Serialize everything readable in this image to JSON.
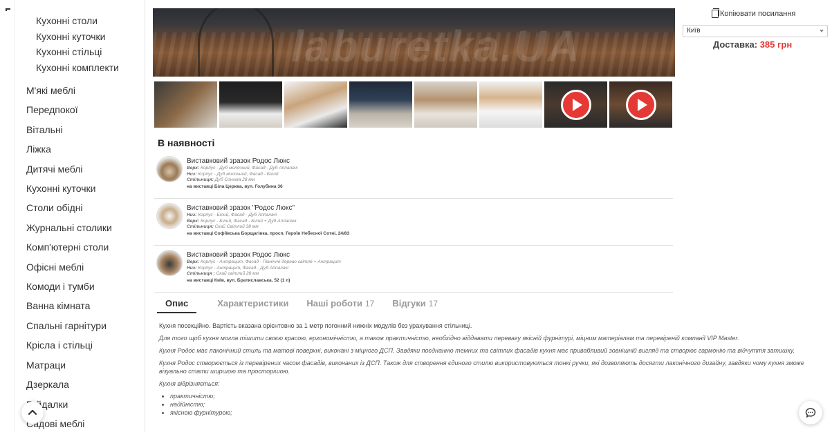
{
  "sidebar": {
    "subcategories": [
      "Кухонні столи",
      "Кухонні куточки",
      "Кухонні стільці",
      "Кухонні комплекти"
    ],
    "categories": [
      "М'які меблі",
      "Передпокої",
      "Вітальні",
      "Ліжка",
      "Дитячі меблі",
      "Кухонні куточки",
      "Столи обідні",
      "Журнальні столики",
      "Комп'ютерні столи",
      "Офісні меблі",
      "Комоди і тумби",
      "Ванна кімната",
      "Спальні гарнітури",
      "Крісла і стільці",
      "Матраци",
      "Дзеркала",
      "Гойдалки",
      "Садові меблі"
    ]
  },
  "gallery": {
    "watermark": "laburetka.UA",
    "thumb_count": 8,
    "video_thumbs": [
      7,
      8
    ]
  },
  "availability": {
    "title": "В наявності",
    "items": [
      {
        "name": "Виставковий зразок Родос Люкс",
        "specs": [
          {
            "label": "Верх:",
            "value": "Корпус - Дуб молочний, Фасад - Дуб Аппалачі"
          },
          {
            "label": "Низ:",
            "value": "Корпус - Дуб молочний, Фасад - Білий"
          },
          {
            "label": "Стільниця:",
            "value": "Дуб Сонома 28 мм"
          }
        ],
        "location": "на виставці Біла Церква, вул. Голубина 36"
      },
      {
        "name": "Виставковий зразок \"Родос Люкс\"",
        "specs": [
          {
            "label": "Низ:",
            "value": "Корпус - Білий, Фасад - Дуб Аппалачі"
          },
          {
            "label": "Верх:",
            "value": "Корпус - Білий, Фасад - Білий + Дуб Аппалачі"
          },
          {
            "label": "Стільниця:",
            "value": "Скай Світлий 38 мм"
          }
        ],
        "location": "на виставці Софіївська Борщагівка, просп. Героїв Небесної Сотні, 24/83"
      },
      {
        "name": "Виставковий зразок Родос Люкс",
        "specs": [
          {
            "label": "Верх:",
            "value": "Корпус - Антрацит, Фасад - Північне дерево світле + Антрацит"
          },
          {
            "label": "Низ:",
            "value": "Корпус - Антрацит, Фасад - Дуб Аппалачі"
          },
          {
            "label": "Стільниця :",
            "value": "Скай світлий 28 мм"
          }
        ],
        "location": "на виставці Київ, вул. Братиславська, 52 (1 п)"
      }
    ]
  },
  "tabs": [
    {
      "label": "Опис",
      "count": "",
      "active": true
    },
    {
      "label": "Характеристики",
      "count": "",
      "active": false
    },
    {
      "label": "Наші роботи",
      "count": "17",
      "active": false
    },
    {
      "label": "Відгуки",
      "count": "17",
      "active": false
    }
  ],
  "description": {
    "p1": "Кухня посекційно. Вартість вказана орієнтовно за 1 метр погонний нижніх модулів без урахування стільниці.",
    "p2": "Для того щоб кухня могла тішити своєю красою, ергономічністю, а також практичністю, необхідно віддавати перевагу якісній фурнітурі, міцним матеріалам та перевіреній компанії VIP Master.",
    "p3": "Кухня Родос має лаконічний стиль та матові поверхні, виконані з міцного ДСП. Завдяки поєднанню темних та світлих фасадів кухня має привабливий зовнішній вигляд та створює гармонію та відчуття затишку.",
    "p4": "Кухня Родос створюється із перевірених часом фасадів, виконаних із ДСП. Також для створення єдиного стилю використовуються тонкі ручки, які дозволяють досягти лаконічного дизайну, завдяки чому кухня зможе візуально стати ширшою та просторішою.",
    "p5": "Кухня відрізняється:",
    "list": [
      "практичністю;",
      "надійністю;",
      "якісною фурнітурою;"
    ]
  },
  "right": {
    "copy_link": "Копіювати посилання",
    "city": "Київ",
    "delivery_label": "Доставка:",
    "delivery_price": "385 грн"
  },
  "colors": {
    "accent": "#e53935"
  }
}
